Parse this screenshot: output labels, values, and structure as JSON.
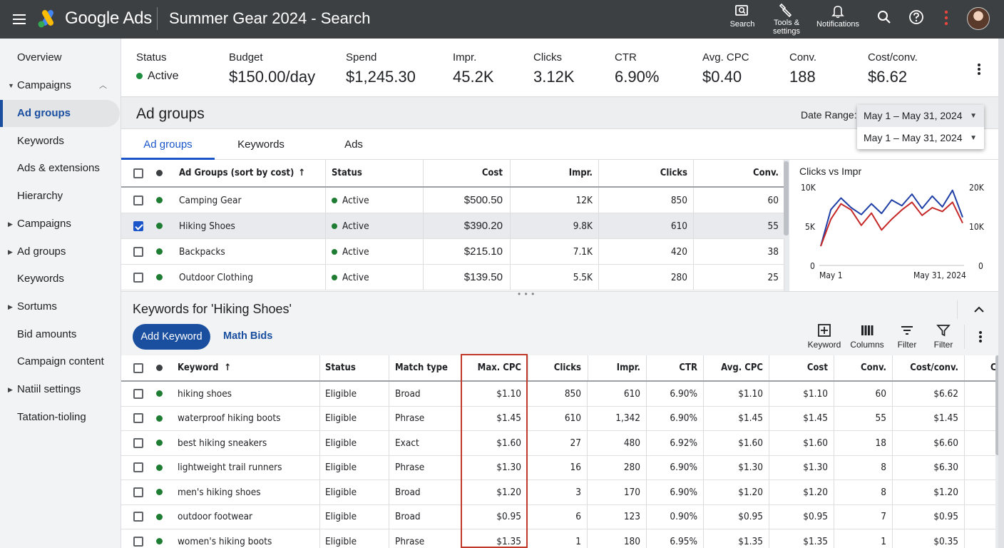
{
  "topbar": {
    "brand": "Google Ads",
    "campaign_title": "Summer Gear 2024 - Search",
    "actions": [
      {
        "icon": "search-icon",
        "label": "Search"
      },
      {
        "icon": "wrench-icon",
        "label_line1": "Tools &",
        "label_line2": "settings"
      },
      {
        "icon": "bell-icon",
        "label": "Notifications"
      }
    ]
  },
  "sidebar": {
    "items": [
      {
        "label": "Overview"
      },
      {
        "label": "Campaigns",
        "expanded": true
      },
      {
        "label": "Ad groups",
        "active": true
      },
      {
        "label": "Keywords"
      },
      {
        "label": "Ads & extensions"
      },
      {
        "label": "Hierarchy"
      },
      {
        "label": "Campaigns",
        "collapsed": true
      },
      {
        "label": "Ad groups",
        "collapsed": true
      },
      {
        "label": "Keywords"
      },
      {
        "label": "Sortums",
        "collapsed": true
      },
      {
        "label": "Bid amounts"
      },
      {
        "label": "Campaign content"
      },
      {
        "label": "Natiil settings",
        "collapsed": true
      },
      {
        "label": "Tatation-tioling"
      }
    ]
  },
  "stats": {
    "status_label": "Status",
    "status_value": "Active",
    "budget_label": "Budget",
    "budget_value": "$150.00/day",
    "spend_label": "Spend",
    "spend_value": "$1,245.30",
    "impr_label": "Impr.",
    "impr_value": "45.2K",
    "clicks_label": "Clicks",
    "clicks_value": "3.12K",
    "ctr_label": "CTR",
    "ctr_value": "6.90%",
    "avgcpc_label": "Avg. CPC",
    "avgcpc_value": "$0.40",
    "conv_label": "Conv.",
    "conv_value": "188",
    "costconv_label": "Cost/conv.",
    "costconv_value": "$6.62"
  },
  "adgroups": {
    "title": "Ad groups",
    "date_range_label": "Date Range:",
    "date_options": [
      "May 1 – May 31, 2024",
      "May 1 – May 31, 2024"
    ],
    "tabs": [
      "Ad groups",
      "Keywords",
      "Ads"
    ],
    "active_tab": "Ad groups",
    "headers": {
      "name": "Ad Groups (sort by cost)",
      "status": "Status",
      "cost": "Cost",
      "impr": "Impr.",
      "clicks": "Clicks",
      "conv": "Conv."
    },
    "rows": [
      {
        "name": "Camping Gear",
        "status": "Active",
        "cost": "$500.50",
        "impr": "12K",
        "clicks": "850",
        "conv": "60",
        "checked": false
      },
      {
        "name": "Hiking Shoes",
        "status": "Active",
        "cost": "$390.20",
        "impr": "9.8K",
        "clicks": "610",
        "conv": "55",
        "checked": true
      },
      {
        "name": "Backpacks",
        "status": "Active",
        "cost": "$215.10",
        "impr": "7.1K",
        "clicks": "420",
        "conv": "38",
        "checked": false
      },
      {
        "name": "Outdoor Clothing",
        "status": "Active",
        "cost": "$139.50",
        "impr": "5.5K",
        "clicks": "280",
        "conv": "25",
        "checked": false
      }
    ]
  },
  "chart_data": {
    "type": "line",
    "title": "Clicks vs Impr",
    "x_start_label": "May 1",
    "x_end_label": "May 31, 2024",
    "y_left_ticks": [
      "10K",
      "5K",
      "0"
    ],
    "y_right_ticks": [
      "20K",
      "10K",
      "0"
    ],
    "ylim_left": [
      0,
      10000
    ],
    "ylim_right": [
      0,
      20000
    ],
    "series": [
      {
        "color": "#1f3fa6",
        "axis": "right",
        "values": [
          5000,
          14500,
          17500,
          15000,
          13200,
          16000,
          13500,
          17000,
          15500,
          18500,
          14800,
          18000,
          15200,
          19500,
          12500
        ]
      },
      {
        "color": "#c62828",
        "axis": "left",
        "values": [
          2500,
          6000,
          8000,
          7200,
          5200,
          6800,
          4600,
          6000,
          7200,
          8200,
          6500,
          7500,
          7000,
          8200,
          5500
        ]
      }
    ]
  },
  "keywords": {
    "title": "Keywords for 'Hiking Shoes'",
    "add_button": "Add Keyword",
    "math_bids": "Math Bids",
    "tools": [
      {
        "icon": "add-box-icon",
        "label": "Keyword"
      },
      {
        "icon": "columns-icon",
        "label": "Columns"
      },
      {
        "icon": "filter-lines-icon",
        "label": "Filter"
      },
      {
        "icon": "funnel-icon",
        "label": "Filter"
      }
    ],
    "headers": {
      "keyword": "Keyword",
      "status": "Status",
      "match": "Match type",
      "maxcpc": "Max. CPC",
      "clicks": "Clicks",
      "impr": "Impr.",
      "ctr": "CTR",
      "avgcpc": "Avg. CPC",
      "cost": "Cost",
      "conv": "Conv.",
      "costconv": "Cost/conv.",
      "extra": "C"
    },
    "rows": [
      {
        "keyword": "hiking shoes",
        "status": "Eligible",
        "match": "Broad",
        "maxcpc": "$1.10",
        "clicks": "850",
        "impr": "610",
        "ctr": "6.90%",
        "avgcpc": "$1.10",
        "cost": "$1.10",
        "conv": "60",
        "costconv": "$6.62"
      },
      {
        "keyword": "waterproof hiking boots",
        "status": "Eligible",
        "match": "Phrase",
        "maxcpc": "$1.45",
        "clicks": "610",
        "impr": "1,342",
        "ctr": "6.90%",
        "avgcpc": "$1.45",
        "cost": "$1.45",
        "conv": "55",
        "costconv": "$1.45"
      },
      {
        "keyword": "best hiking sneakers",
        "status": "Eligible",
        "match": "Exact",
        "maxcpc": "$1.60",
        "clicks": "27",
        "impr": "480",
        "ctr": "6.92%",
        "avgcpc": "$1.60",
        "cost": "$1.60",
        "conv": "18",
        "costconv": "$6.60"
      },
      {
        "keyword": "lightweight trail runners",
        "status": "Eligible",
        "match": "Phrase",
        "maxcpc": "$1.30",
        "clicks": "16",
        "impr": "280",
        "ctr": "6.90%",
        "avgcpc": "$1.30",
        "cost": "$1.30",
        "conv": "8",
        "costconv": "$6.30"
      },
      {
        "keyword": "men's hiking shoes",
        "status": "Eligible",
        "match": "Broad",
        "maxcpc": "$1.20",
        "clicks": "3",
        "impr": "170",
        "ctr": "6.90%",
        "avgcpc": "$1.20",
        "cost": "$1.20",
        "conv": "8",
        "costconv": "$1.20"
      },
      {
        "keyword": "outdoor footwear",
        "status": "Eligible",
        "match": "Broad",
        "maxcpc": "$0.95",
        "clicks": "6",
        "impr": "123",
        "ctr": "0.90%",
        "avgcpc": "$0.95",
        "cost": "$0.95",
        "conv": "7",
        "costconv": "$0.95"
      },
      {
        "keyword": "women's hiking boots",
        "status": "Eligible",
        "match": "Phrase",
        "maxcpc": "$1.35",
        "clicks": "1",
        "impr": "180",
        "ctr": "6.95%",
        "avgcpc": "$1.35",
        "cost": "$1.35",
        "conv": "1",
        "costconv": "$0.35"
      }
    ]
  },
  "colors": {
    "topbar": "#3c4043",
    "accent_blue": "#1a56c9",
    "status_green": "#1e8e3e",
    "highlight_red": "#c0392b"
  }
}
